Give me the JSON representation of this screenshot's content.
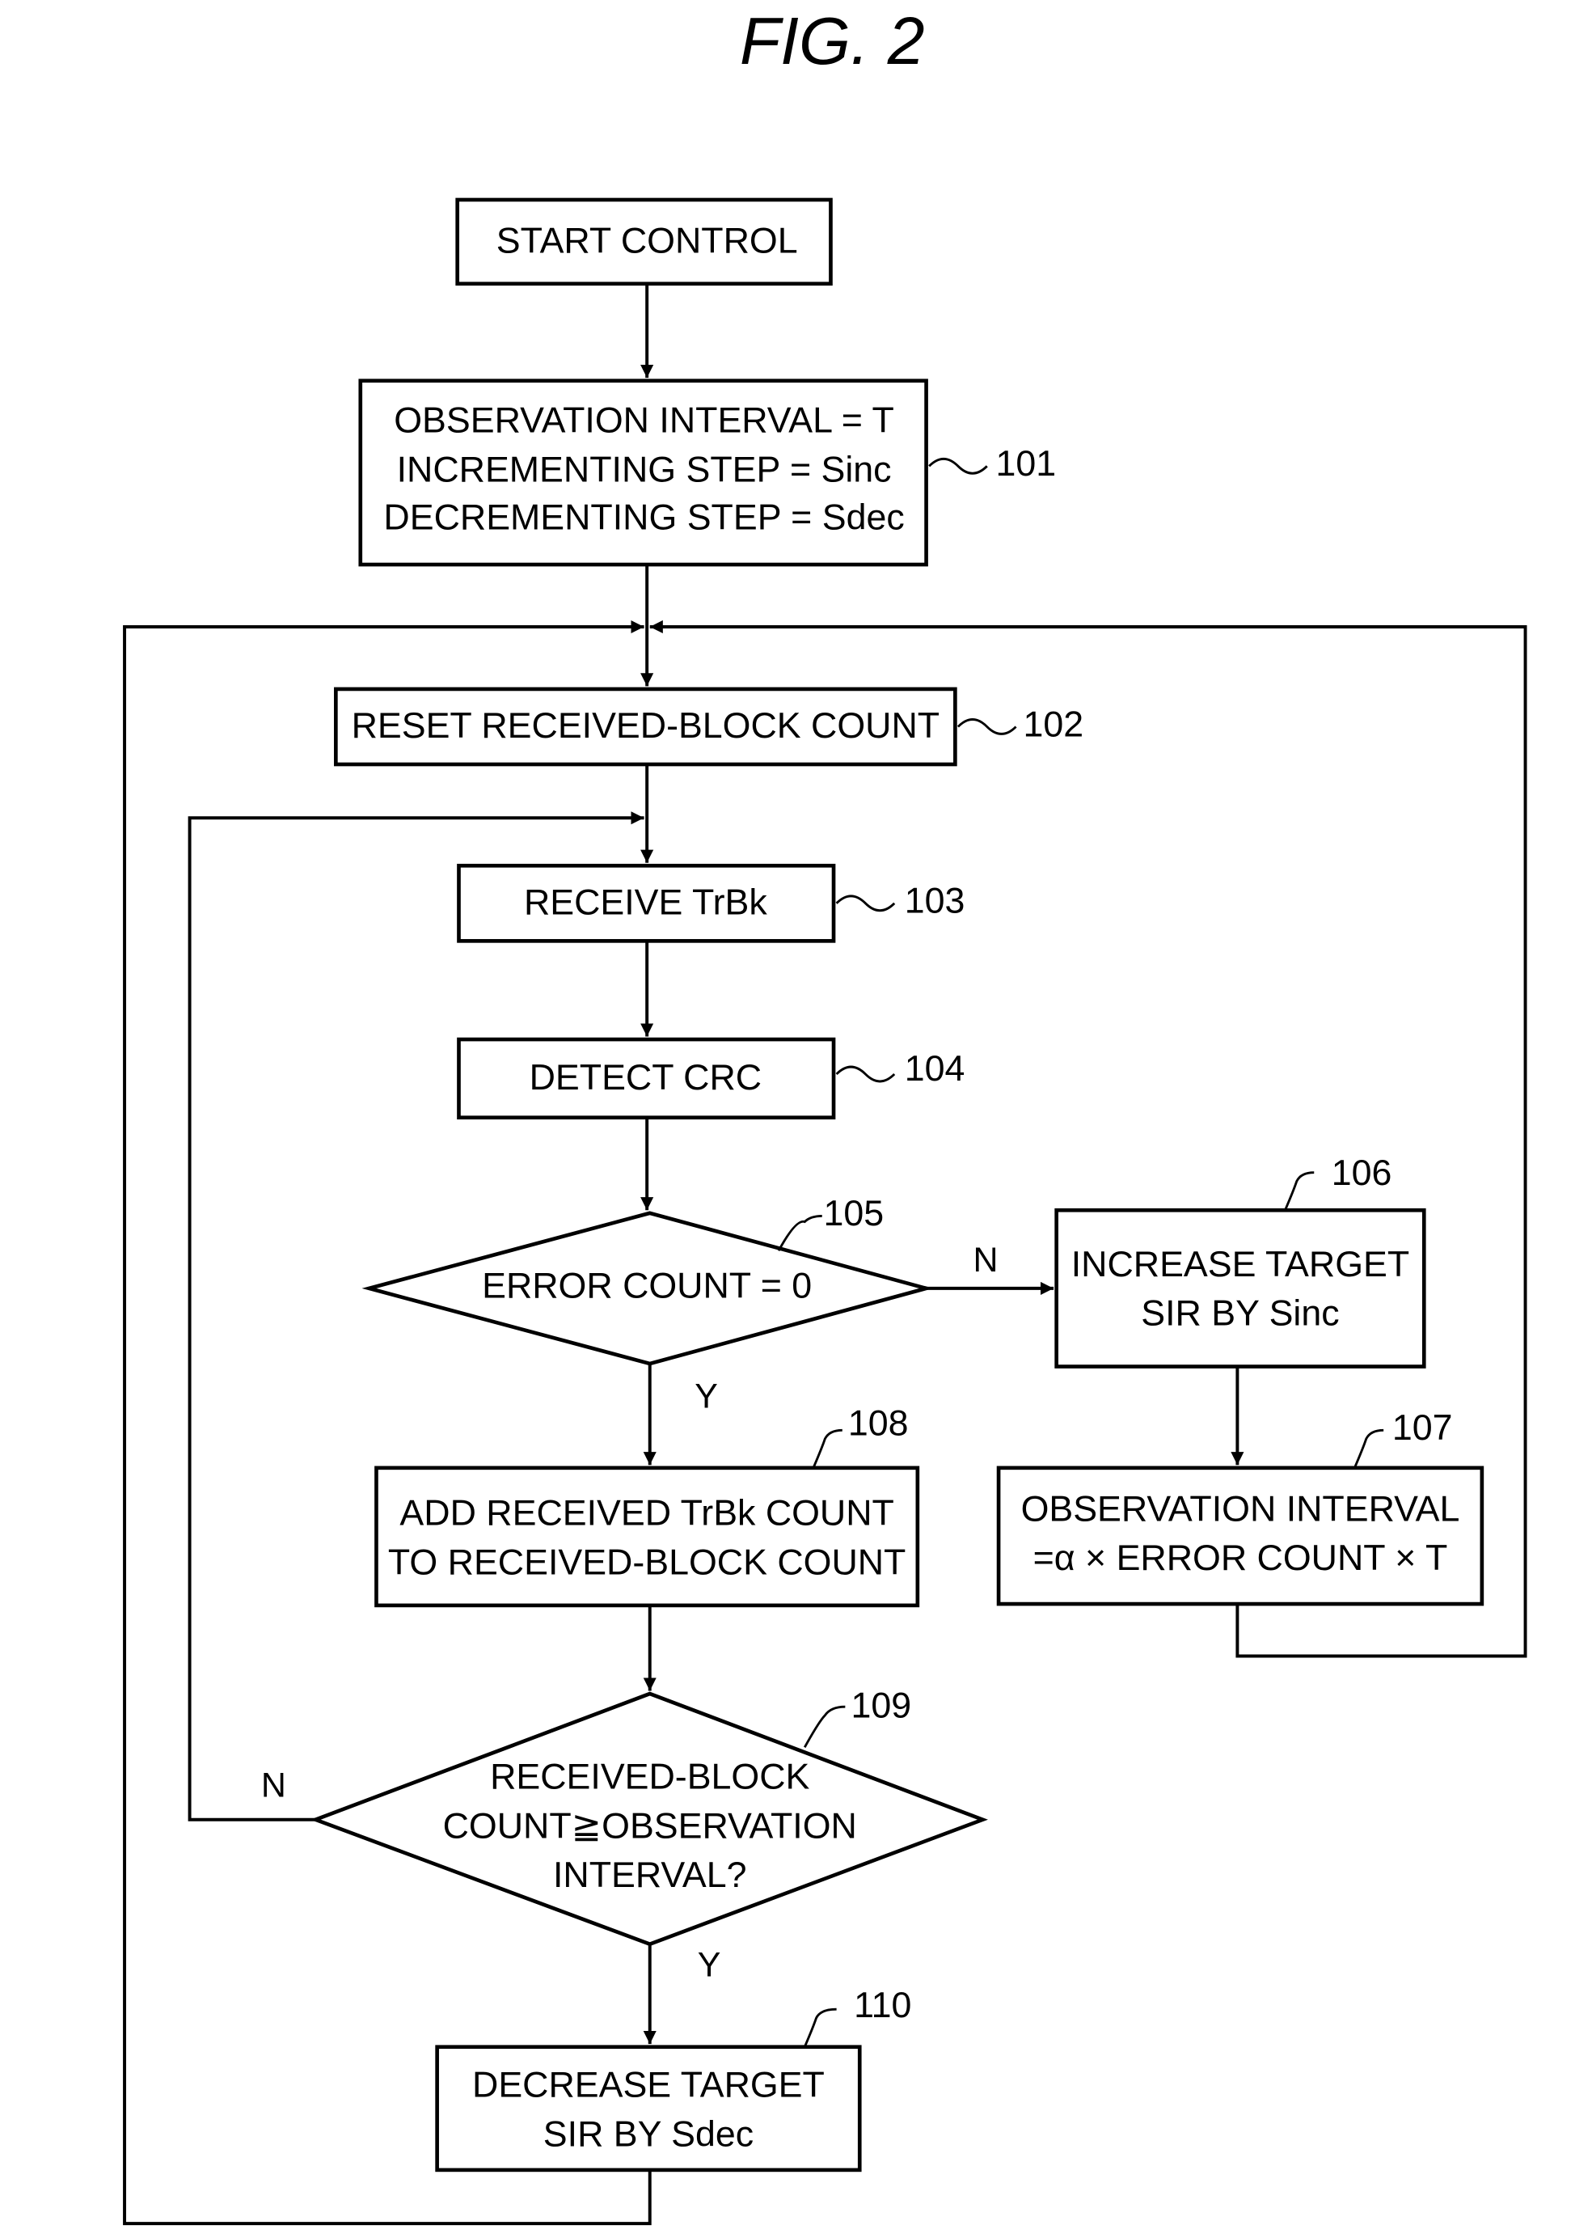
{
  "figure": {
    "title": "FIG. 2"
  },
  "steps": {
    "start": {
      "lines": [
        "START CONTROL"
      ]
    },
    "s101": {
      "ref": "101",
      "lines": [
        "OBSERVATION INTERVAL = T",
        "INCREMENTING STEP = Sinc",
        "DECREMENTING STEP = Sdec"
      ]
    },
    "s102": {
      "ref": "102",
      "lines": [
        "RESET RECEIVED-BLOCK COUNT"
      ]
    },
    "s103": {
      "ref": "103",
      "lines": [
        "RECEIVE TrBk"
      ]
    },
    "s104": {
      "ref": "104",
      "lines": [
        "DETECT CRC"
      ]
    },
    "s105": {
      "ref": "105",
      "type": "decision",
      "lines": [
        "ERROR COUNT = 0"
      ],
      "yes": "Y",
      "no": "N"
    },
    "s106": {
      "ref": "106",
      "lines": [
        "INCREASE TARGET",
        "SIR BY Sinc"
      ]
    },
    "s107": {
      "ref": "107",
      "lines": [
        "OBSERVATION INTERVAL",
        "=α × ERROR COUNT × T"
      ]
    },
    "s108": {
      "ref": "108",
      "lines": [
        "ADD RECEIVED TrBk COUNT",
        "TO RECEIVED-BLOCK COUNT"
      ]
    },
    "s109": {
      "ref": "109",
      "type": "decision",
      "lines": [
        "RECEIVED-BLOCK",
        "COUNT≧OBSERVATION",
        "INTERVAL?"
      ],
      "yes": "Y",
      "no": "N"
    },
    "s110": {
      "ref": "110",
      "lines": [
        "DECREASE TARGET",
        "SIR BY Sdec"
      ]
    }
  },
  "edges": [
    {
      "from": "start",
      "to": "s101"
    },
    {
      "from": "s101",
      "to": "s102"
    },
    {
      "from": "s102",
      "to": "s103"
    },
    {
      "from": "s103",
      "to": "s104"
    },
    {
      "from": "s104",
      "to": "s105"
    },
    {
      "from": "s105",
      "to": "s106",
      "label": "N"
    },
    {
      "from": "s105",
      "to": "s108",
      "label": "Y"
    },
    {
      "from": "s106",
      "to": "s107"
    },
    {
      "from": "s107",
      "to": "s102"
    },
    {
      "from": "s108",
      "to": "s109"
    },
    {
      "from": "s109",
      "to": "s103",
      "label": "N"
    },
    {
      "from": "s109",
      "to": "s110",
      "label": "Y"
    },
    {
      "from": "s110",
      "to": "s102"
    }
  ]
}
